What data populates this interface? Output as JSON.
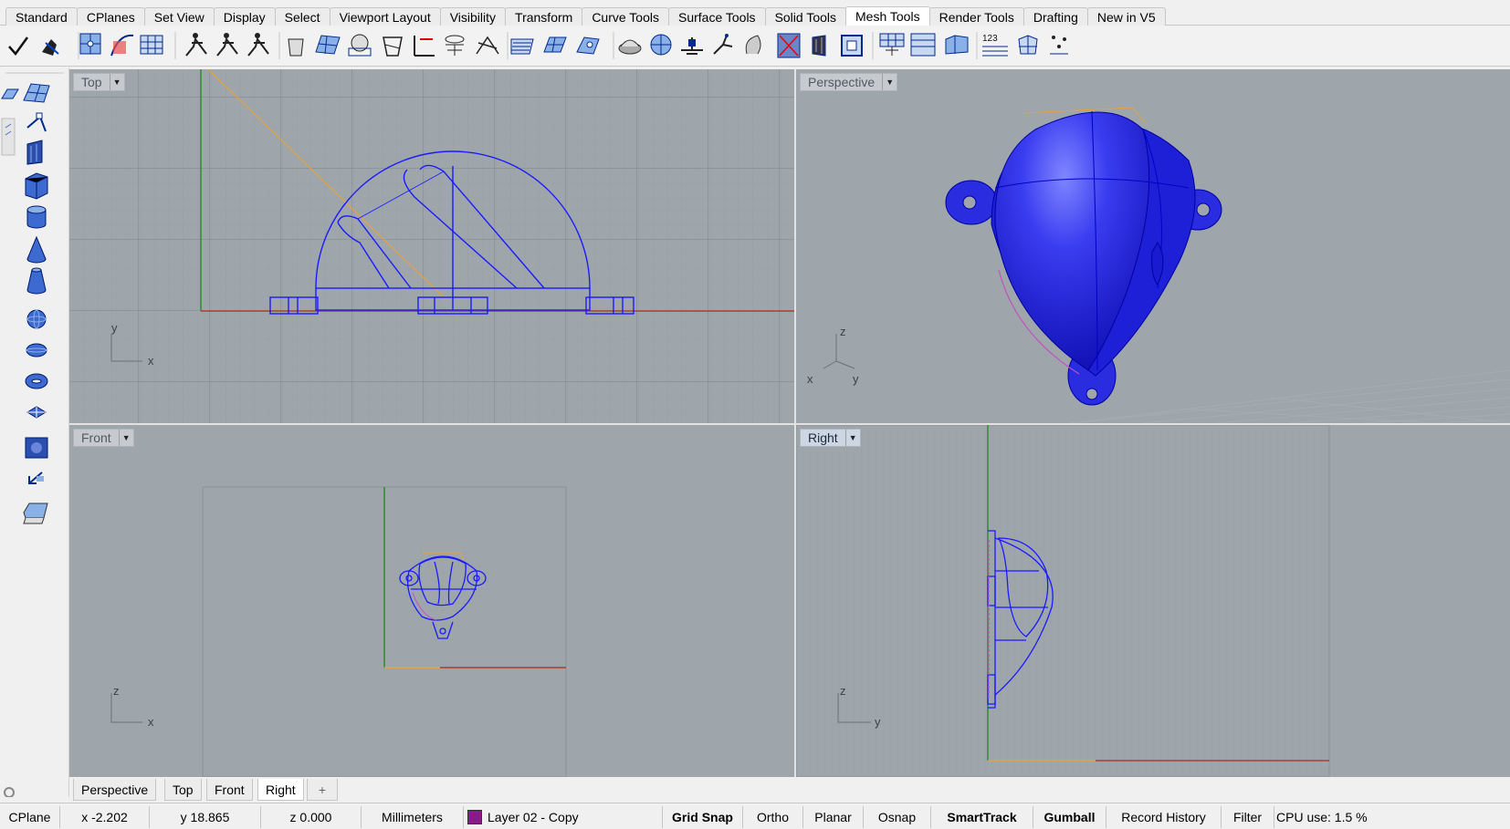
{
  "tabs": [
    "Standard",
    "CPlanes",
    "Set View",
    "Display",
    "Select",
    "Viewport Layout",
    "Visibility",
    "Transform",
    "Curve Tools",
    "Surface Tools",
    "Solid Tools",
    "Mesh Tools",
    "Render Tools",
    "Drafting",
    "New in V5"
  ],
  "active_tab": "Mesh Tools",
  "toolbar": {
    "icons": [
      "checkmark-icon",
      "mesh-repair-icon",
      "mesh-grid-icon",
      "mesh-curve-icon",
      "mesh-patch-icon",
      "mesh-person-1-icon",
      "mesh-person-2-icon",
      "mesh-person-3-icon",
      "mesh-cup-icon",
      "mesh-plane-icon",
      "mesh-skull-icon",
      "mesh-box-icon",
      "mesh-split-icon",
      "mesh-trim-icon",
      "mesh-intersect-icon",
      "mesh-layer-icon",
      "mesh-flat-icon",
      "mesh-flip-icon",
      "mesh-saddle-icon",
      "mesh-sphere-icon",
      "mesh-cut-icon",
      "mesh-pull-icon",
      "mesh-hook-icon",
      "mesh-target-icon",
      "mesh-fold-icon",
      "mesh-frame-icon",
      "mesh-split-h-icon",
      "mesh-split-v-icon",
      "mesh-wall-icon",
      "mesh-count-icon",
      "mesh-unweld-icon",
      "mesh-scatter-icon"
    ],
    "count_label": "123"
  },
  "left_toolbar": {
    "icons": [
      "plane-icon",
      "surface-icon",
      "curve-point-icon",
      "box-panel-icon",
      "box-solid-icon",
      "cylinder-icon",
      "cone-icon",
      "truncated-cone-icon",
      "sphere-icon",
      "ellipsoid-icon",
      "torus-icon",
      "pipe-icon",
      "texture-icon",
      "extrude-icon",
      "slab-icon"
    ]
  },
  "viewports": {
    "top": {
      "label": "Top",
      "axis_a": "y",
      "axis_b": "x"
    },
    "perspective": {
      "label": "Perspective",
      "axis_a": "z",
      "axis_b": "x",
      "axis_c": "y"
    },
    "front": {
      "label": "Front",
      "axis_a": "z",
      "axis_b": "x"
    },
    "right": {
      "label": "Right",
      "axis_a": "z",
      "axis_b": "y"
    }
  },
  "active_viewport": "Right",
  "view_tabs": [
    "Perspective",
    "Top",
    "Front",
    "Right"
  ],
  "add_view_glyph": "+",
  "status": {
    "cplane": "CPlane",
    "x": "x -2.202",
    "y": "y 18.865",
    "z": "z 0.000",
    "units": "Millimeters",
    "layer": "Layer 02 - Copy",
    "layer_color": "#8b1a8b",
    "grid_snap": "Grid Snap",
    "ortho": "Ortho",
    "planar": "Planar",
    "osnap": "Osnap",
    "smarttrack": "SmartTrack",
    "gumball": "Gumball",
    "record_history": "Record History",
    "filter": "Filter",
    "cpu": "CPU use: 1.5 %"
  },
  "colors": {
    "viewport_bg": "#9ea6ac",
    "grid_line": "#8e969c",
    "grid_major": "#7f878d",
    "wire": "#1a1aff",
    "x_axis": "#b03a2e",
    "y_axis": "#2e8b2e",
    "selection": "#e6a23c"
  }
}
